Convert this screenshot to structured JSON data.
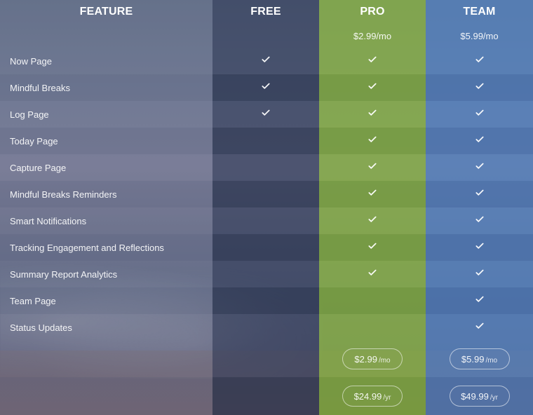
{
  "table": {
    "headers": {
      "feature": "FEATURE",
      "free": "FREE",
      "pro": "PRO",
      "team": "TEAM"
    },
    "prices": {
      "free": "",
      "pro": "$2.99/mo",
      "team": "$5.99/mo"
    },
    "features": [
      {
        "name": "Now Page",
        "free": true,
        "pro": true,
        "team": true
      },
      {
        "name": "Mindful Breaks",
        "free": true,
        "pro": true,
        "team": true
      },
      {
        "name": "Log Page",
        "free": true,
        "pro": true,
        "team": true
      },
      {
        "name": "Today Page",
        "free": false,
        "pro": true,
        "team": true
      },
      {
        "name": "Capture Page",
        "free": false,
        "pro": true,
        "team": true
      },
      {
        "name": "Mindful Breaks Reminders",
        "free": false,
        "pro": true,
        "team": true
      },
      {
        "name": "Smart Notifications",
        "free": false,
        "pro": true,
        "team": true
      },
      {
        "name": "Tracking Engagement and Reflections",
        "free": false,
        "pro": true,
        "team": true
      },
      {
        "name": "Summary Report Analytics",
        "free": false,
        "pro": true,
        "team": true
      },
      {
        "name": "Team Page",
        "free": false,
        "pro": false,
        "team": true
      },
      {
        "name": "Status Updates",
        "free": false,
        "pro": false,
        "team": true
      }
    ],
    "cta": {
      "pro_monthly": {
        "amount": "$2.99",
        "unit": "/mo"
      },
      "team_monthly": {
        "amount": "$5.99",
        "unit": "/mo"
      },
      "pro_yearly": {
        "amount": "$24.99",
        "unit": "/yr"
      },
      "team_yearly": {
        "amount": "$49.99",
        "unit": "/yr"
      }
    }
  },
  "icons": {
    "check": "check-icon"
  },
  "colors": {
    "pro_accent": "#86AF3C",
    "team_accent": "#4C7EBE",
    "free_column": "#283450"
  }
}
